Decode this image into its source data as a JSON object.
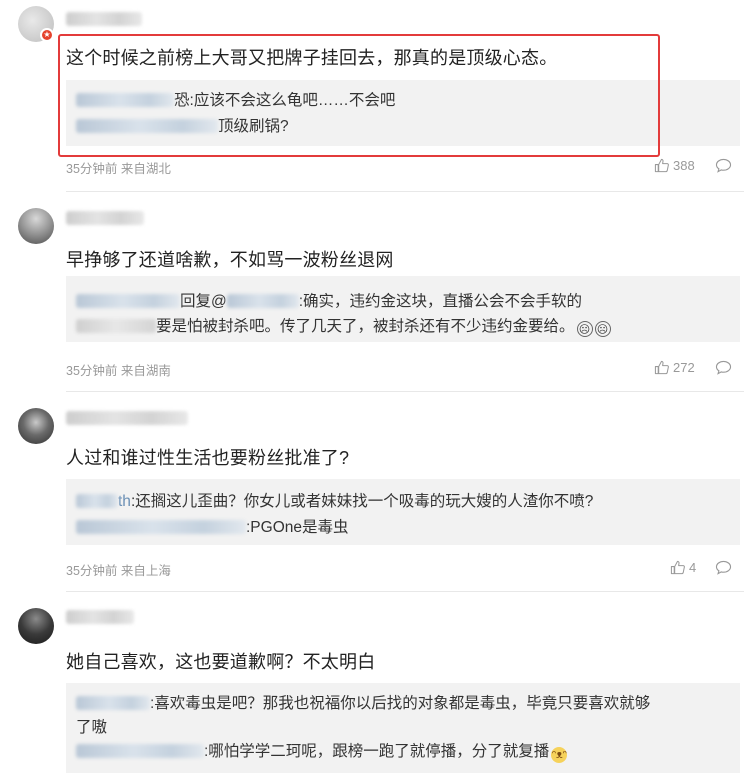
{
  "comments": [
    {
      "text": "这个时候之前榜上大哥又把牌子挂回去，那真的是顶级心态。",
      "replies": [
        {
          "name_suffix": "恐",
          "text": ":应该不会这么龟吧……不会吧"
        },
        {
          "name_suffix": "",
          "text": "顶级刷锅?"
        }
      ],
      "meta": "35分钟前 来自湖北",
      "likes": "388"
    },
    {
      "text": "早挣够了还道啥歉，不如骂一波粉丝退网",
      "replies": [
        {
          "name_suffix": "回复@",
          "text": ":确实，违约金这块，直播公会不会手软的"
        },
        {
          "name_suffix": "",
          "text": "要是怕被封杀吧。传了几天了，被封杀还有不少违约金要给。"
        }
      ],
      "meta": "35分钟前 来自湖南",
      "likes": "272"
    },
    {
      "text": "人过和谁过性生活也要粉丝批准了?",
      "replies": [
        {
          "name_suffix": "th",
          "text": ":还搁这儿歪曲？你女儿或者妹妹找一个吸毒的玩大嫂的人渣你不喷?"
        },
        {
          "name_suffix": "",
          "text": ":PGOne是毒虫"
        }
      ],
      "meta": "35分钟前 来自上海",
      "likes": "4"
    },
    {
      "text": "她自己喜欢，这也要道歉啊？不太明白",
      "replies": [
        {
          "name_suffix": "",
          "text": ":喜欢毒虫是吧？那我也祝福你以后找的对象都是毒虫，毕竟只要喜欢就够"
        },
        {
          "name_suffix": "",
          "text": "了嗷"
        },
        {
          "name_suffix": "",
          "text": ":哪怕学学二珂呢，跟榜一跑了就停播，分了就复播"
        }
      ],
      "meta": "",
      "likes": ""
    }
  ],
  "colors": {
    "highlight": "#e33b3b",
    "reply_bg": "#f2f2f2",
    "meta": "#999999"
  },
  "icons": [
    "thumb-up-icon",
    "comment-icon",
    "verified-badge-icon",
    "crying-emoji",
    "cat-emoji"
  ]
}
